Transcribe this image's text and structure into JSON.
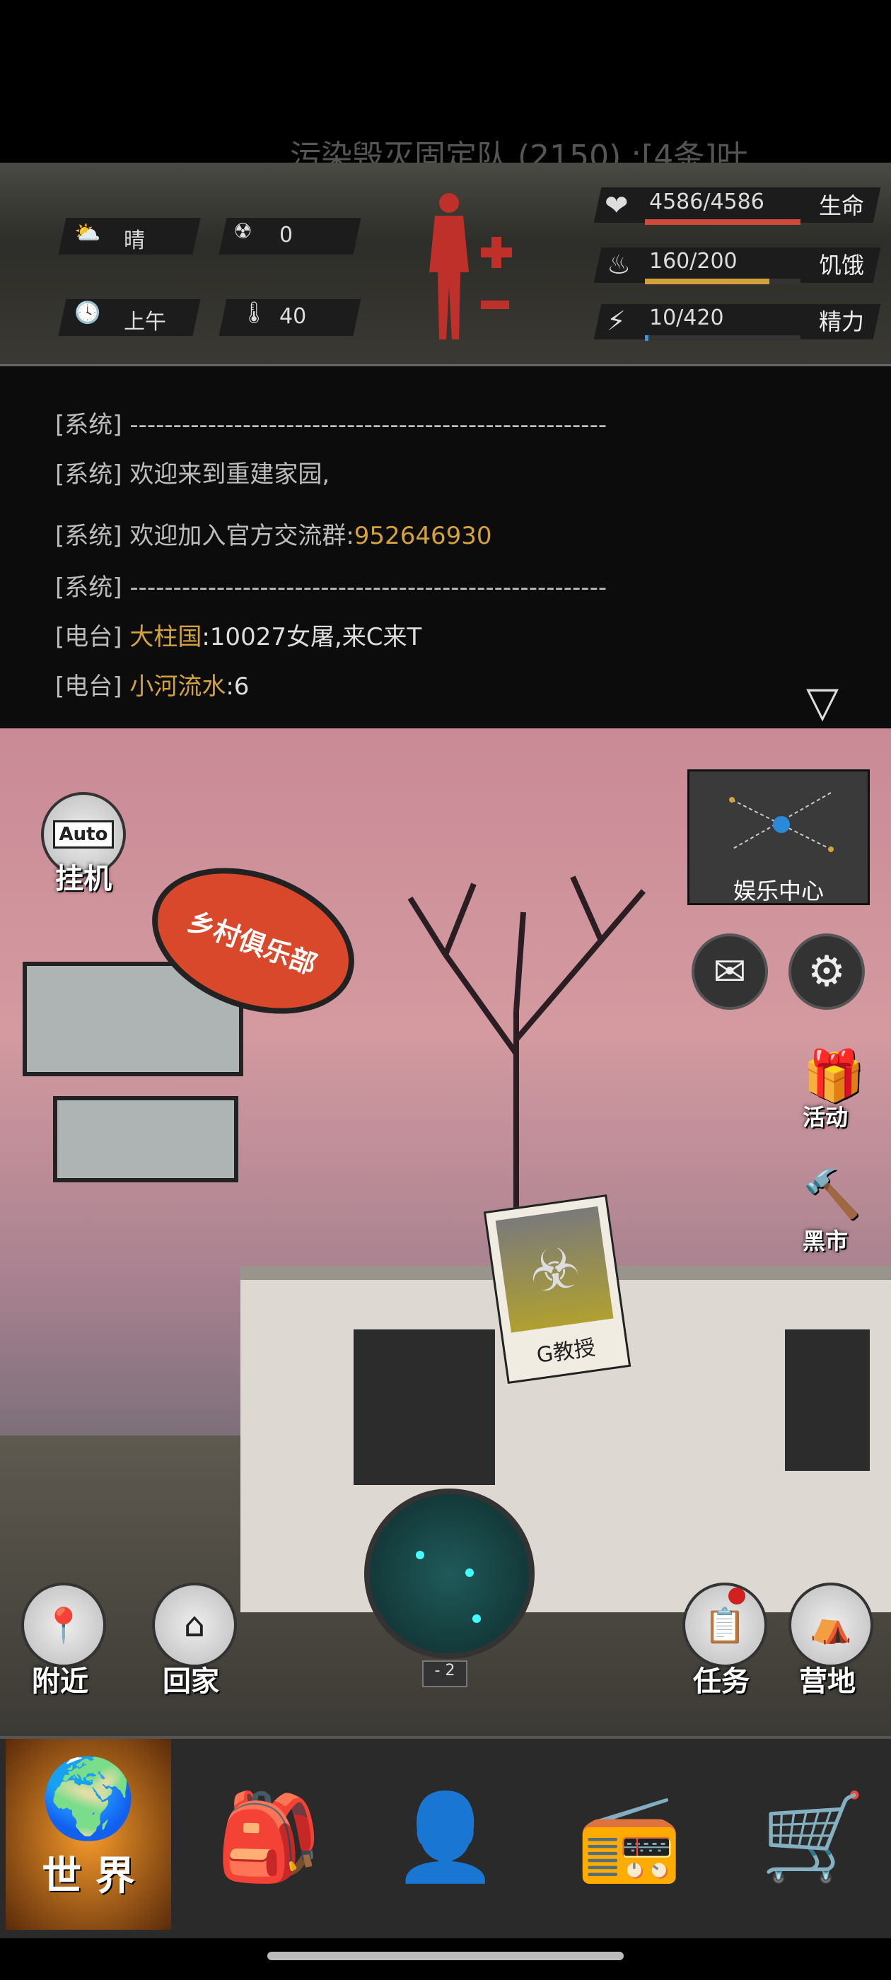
{
  "marquee": "污染毁灭固定队 (2150) :[4条]叶",
  "weather": {
    "label": "晴",
    "radiation": "0",
    "time": "上午",
    "temperature": "40"
  },
  "stats": [
    {
      "value": "4586/4586",
      "label": "生命",
      "fill": 1.0,
      "color": "#d04a3a"
    },
    {
      "value": "160/200",
      "label": "饥饿",
      "fill": 0.8,
      "color": "#d4a23a"
    },
    {
      "value": "10/420",
      "label": "精力",
      "fill": 0.024,
      "color": "#4a90d0"
    }
  ],
  "chat": [
    {
      "tag": "[系统]",
      "text": "-------------------------------------------------------",
      "hl": ""
    },
    {
      "tag": "[系统]",
      "text": "欢迎来到重建家园,",
      "hl": ""
    },
    {
      "tag": "[系统]",
      "text": " 欢迎加入官方交流群:",
      "hl": "952646930"
    },
    {
      "tag": "[系统]",
      "text": "-------------------------------------------------------",
      "hl": ""
    },
    {
      "tag": "[电台]",
      "text": "",
      "hl": "大柱国",
      "rest": ":10027女屠,来C来T"
    },
    {
      "tag": "[电台]",
      "text": "",
      "hl": "小河流水",
      "rest": ":6"
    }
  ],
  "scene": {
    "auto_label": "Auto",
    "idle_label": "挂机",
    "entertainment": "娱乐中心",
    "sign": "乡村俱乐部",
    "npc": "G教授",
    "activity": "活动",
    "black_market": "黑市",
    "nearby": "附近",
    "home": "回家",
    "task": "任务",
    "camp": "营地",
    "radar_level": "- 2"
  },
  "nav": {
    "world": "世 界"
  }
}
